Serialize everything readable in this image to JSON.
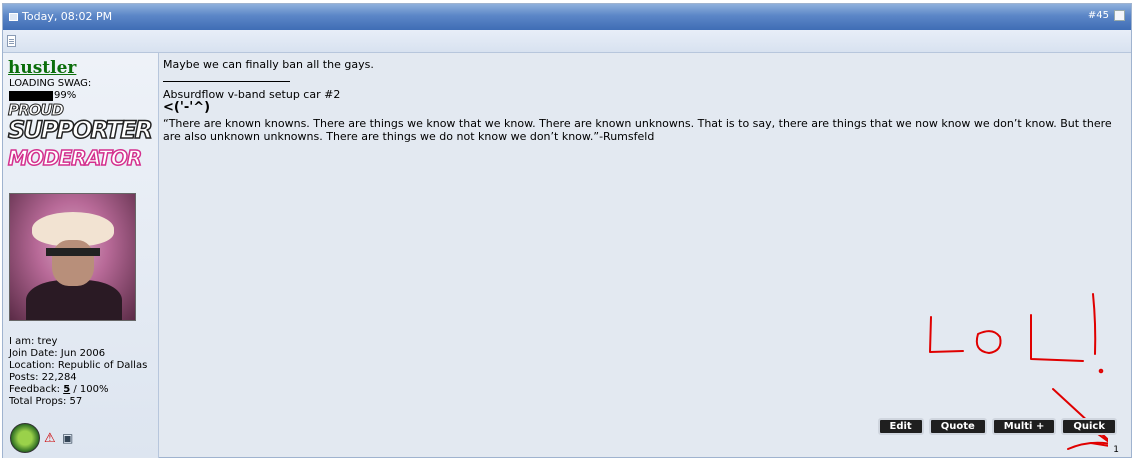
{
  "post": {
    "date": "Today, 08:02 PM",
    "number": "#45"
  },
  "user": {
    "name": "hustler",
    "swag_label": "LOADING SWAG:",
    "swag_pct": "99%",
    "banner1_top": "PROUD",
    "banner1_main": "SUPPORTER",
    "banner2": "MODERATOR",
    "info": [
      "I am: trey",
      "Join Date: Jun 2006",
      "Location: Republic of Dallas",
      "Posts: 22,284"
    ],
    "feedback_label": "Feedback:",
    "feedback_count": "5",
    "feedback_pct": " / 100%",
    "props": "Total Props: 57"
  },
  "message": {
    "text": "Maybe we can finally ban all the gays.",
    "sig_link": "Absurdflow v-band setup car #2",
    "sig_face": "<('-'^)",
    "sig_quote": "“There are known knowns. There are things we know that we know. There are known unknowns. That is to say, there are things that we now know we don’t know. But there are also unknown unknowns. There are things we do not know we don’t know.”-Rumsfeld"
  },
  "annotation_text": "LoL!",
  "buttons": {
    "edit": "Edit",
    "quote": "Quote",
    "multi": "Multi +",
    "quick": "Quick"
  },
  "page_number": "1",
  "colors": {
    "header": "#4f7bbf",
    "username": "#0b6e0b",
    "annotation": "#e00000"
  }
}
